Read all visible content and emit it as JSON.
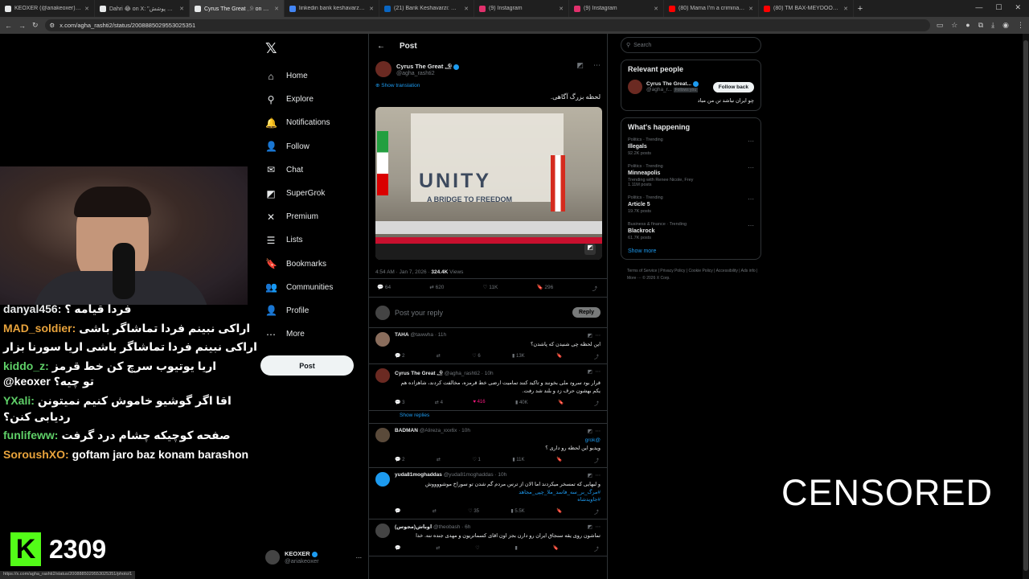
{
  "browser": {
    "tabs": [
      {
        "title": "KEOXER (@ariakeoxer) / X",
        "color": "#e7e9ea"
      },
      {
        "title": "Dahri 😂 on X: \"جا یه رنگه، برای پوشش",
        "color": "#e7e9ea"
      },
      {
        "title": "Cyrus The Great 𓄂 on X: \"ﺶﯾ",
        "color": "#e7e9ea",
        "active": true
      },
      {
        "title": "linkedin bank keshavarzi - Goo",
        "color": "#4285f4"
      },
      {
        "title": "(21) Bank Keshavarzi: Overview",
        "color": "#0a66c2"
      },
      {
        "title": "(9) Instagram",
        "color": "#e1306c"
      },
      {
        "title": "(9) Instagram",
        "color": "#e1306c"
      },
      {
        "title": "(80) Mama I'm a criminal [Offi",
        "color": "#ff0000"
      },
      {
        "title": "(80) TM BAX-MEYDOON OFFIC",
        "color": "#ff0000"
      }
    ],
    "url": "x.com/agha_rashti2/status/2008885029553025351",
    "status_url": "https://x.com/agha_rashti2/status/2008885029553025351/photo/1"
  },
  "nav": {
    "items": [
      {
        "label": "Home",
        "icon": "home-icon",
        "glyph": "⌂"
      },
      {
        "label": "Explore",
        "icon": "search-icon",
        "glyph": "⚲"
      },
      {
        "label": "Notifications",
        "icon": "bell-icon",
        "glyph": "🔔"
      },
      {
        "label": "Follow",
        "icon": "person-plus-icon",
        "glyph": "👤"
      },
      {
        "label": "Chat",
        "icon": "chat-icon",
        "glyph": "✉"
      },
      {
        "label": "SuperGrok",
        "icon": "grok-icon",
        "glyph": "◩"
      },
      {
        "label": "Premium",
        "icon": "x-icon",
        "glyph": "✕"
      },
      {
        "label": "Lists",
        "icon": "lists-icon",
        "glyph": "☰"
      },
      {
        "label": "Bookmarks",
        "icon": "bookmark-icon",
        "glyph": "🔖"
      },
      {
        "label": "Communities",
        "icon": "communities-icon",
        "glyph": "👥"
      },
      {
        "label": "Profile",
        "icon": "profile-icon",
        "glyph": "👤"
      },
      {
        "label": "More",
        "icon": "more-icon",
        "glyph": "⋯"
      }
    ],
    "post_label": "Post",
    "account": {
      "name": "KEOXER",
      "handle": "@ariakeoxer"
    }
  },
  "post": {
    "header": "Post",
    "author": "Cyrus The Great 𓄂",
    "handle": "@agha_rashti2",
    "show_translation": "Show translation",
    "text": "لحظه بزرگ آگاهی.",
    "banner_text": "UNITY",
    "banner_sub": "A BRIDGE TO FREEDOM",
    "time": "4:54 AM · Jan 7, 2026 ·",
    "views": "324.4K",
    "views_label": "Views",
    "stats": {
      "replies": "64",
      "reposts": "620",
      "likes": "11K",
      "bookmarks": "296"
    },
    "reply_placeholder": "Post your reply",
    "reply_button": "Reply"
  },
  "comments": [
    {
      "name": "TAHA",
      "handle": "@tawwha · 11h",
      "text": "این لحظه چی شنیدن که پاشدن؟",
      "r": "2",
      "rt": "",
      "l": "6",
      "v": "13K",
      "avatar": "#8a6d5c"
    },
    {
      "name": "Cyrus The Great 𓄂",
      "handle": "@agha_rashti2 · 10h",
      "text": "قرار بود سرود ملی بخونند و تاکید کنند تمامیت ارضی خط قرمزه، مخالفت کردند، شاهزاده هم یکم بهشون حرف زد و بلند شد رفت.",
      "r": "3",
      "rt": "4",
      "l": "416",
      "v": "40K",
      "avatar": "#6b2a22",
      "liked": true
    },
    {
      "name": "BADMAN",
      "handle": "@Alireza_xxx6x · 10h",
      "text": "@grok\nویدیو این لحظه رو داری ؟",
      "r": "2",
      "rt": "",
      "l": "1",
      "v": "11K",
      "avatar": "#5a4a3a"
    },
    {
      "name": "yuda81moghaddas",
      "handle": "@yuda81moghaddas · 10h",
      "text": "و لبهایی که تمسخر میکردند اما الان از ترس مردم گم شدن تو سوراخ موشووووش\n#مرگ_بر_سه_فاسد_ملا_چپی_مجاهد\n#جاویدشاه",
      "r": "",
      "rt": "",
      "l": "35",
      "v": "5.5K",
      "avatar": "#1d9bf0"
    },
    {
      "name": "اوباش(مجوس)",
      "handle": "@theobash · 6h",
      "text": "تماشون روی یقه سنجاق ایران رو دارن بجز اون اقای کسماتریون و مهدی جنده ننه. خدا",
      "r": "",
      "rt": "",
      "l": "",
      "v": "",
      "avatar": "#444"
    }
  ],
  "show_replies": "Show replies",
  "right": {
    "search_placeholder": "Search",
    "relevant_title": "Relevant people",
    "person": {
      "name": "Cyrus The Great...",
      "handle": "@agha_r...",
      "follows_you": "Follows you",
      "bio": "چو ایران نباشد تن من مباد",
      "button": "Follow back"
    },
    "happening_title": "What's happening",
    "trends": [
      {
        "cat": "Politics · Trending",
        "name": "Illegals",
        "count": "92.2K posts"
      },
      {
        "cat": "Politics · Trending",
        "name": "Minneapolis",
        "sub": "Trending with Renee Nicole, Frey",
        "count": "1.11M posts"
      },
      {
        "cat": "Politics · Trending",
        "name": "Article 5",
        "count": "19.7K posts"
      },
      {
        "cat": "Business & finance · Trending",
        "name": "Blackrock",
        "count": "61.7K posts"
      }
    ],
    "show_more": "Show more",
    "footer": "Terms of Service  |  Privacy Policy  |  Cookie Policy  |  Accessibility  |  Ads info  |  More ···  © 2026 X Corp."
  },
  "chat": {
    "messages": [
      {
        "user": "danyal456:",
        "text": "فردا قیامه ؟",
        "color": "#e7e9ea"
      },
      {
        "user": "MAD_soldier:",
        "text": "اراکی نبینم فردا تماشاگر باشی",
        "color": "#e8a33c"
      },
      {
        "user": "",
        "text": "اراکی نبینم فردا تماشاگر باشی   اریا سورنا بزار",
        "color": "#e8a33c"
      },
      {
        "user": "kiddo_z:",
        "text": "اریا یوتیوب سرچ کن خط قرمز @keoxer تو چیه؟",
        "color": "#5fd068"
      },
      {
        "user": "YXali:",
        "text": "اقا اگر گوشیو خاموش کنیم نمیتونن ردیابی کنن؟",
        "color": "#5fd068"
      },
      {
        "user": "funlifeww:",
        "text": "صفحه کوچیکه چشام درد گرفت",
        "color": "#5fd068"
      },
      {
        "user": "SoroushXO:",
        "text": "goftam jaro baz konam barashon",
        "color": "#e8a33c"
      }
    ],
    "viewer_count": "2309"
  },
  "overlay": {
    "censored": "CENSORED"
  }
}
